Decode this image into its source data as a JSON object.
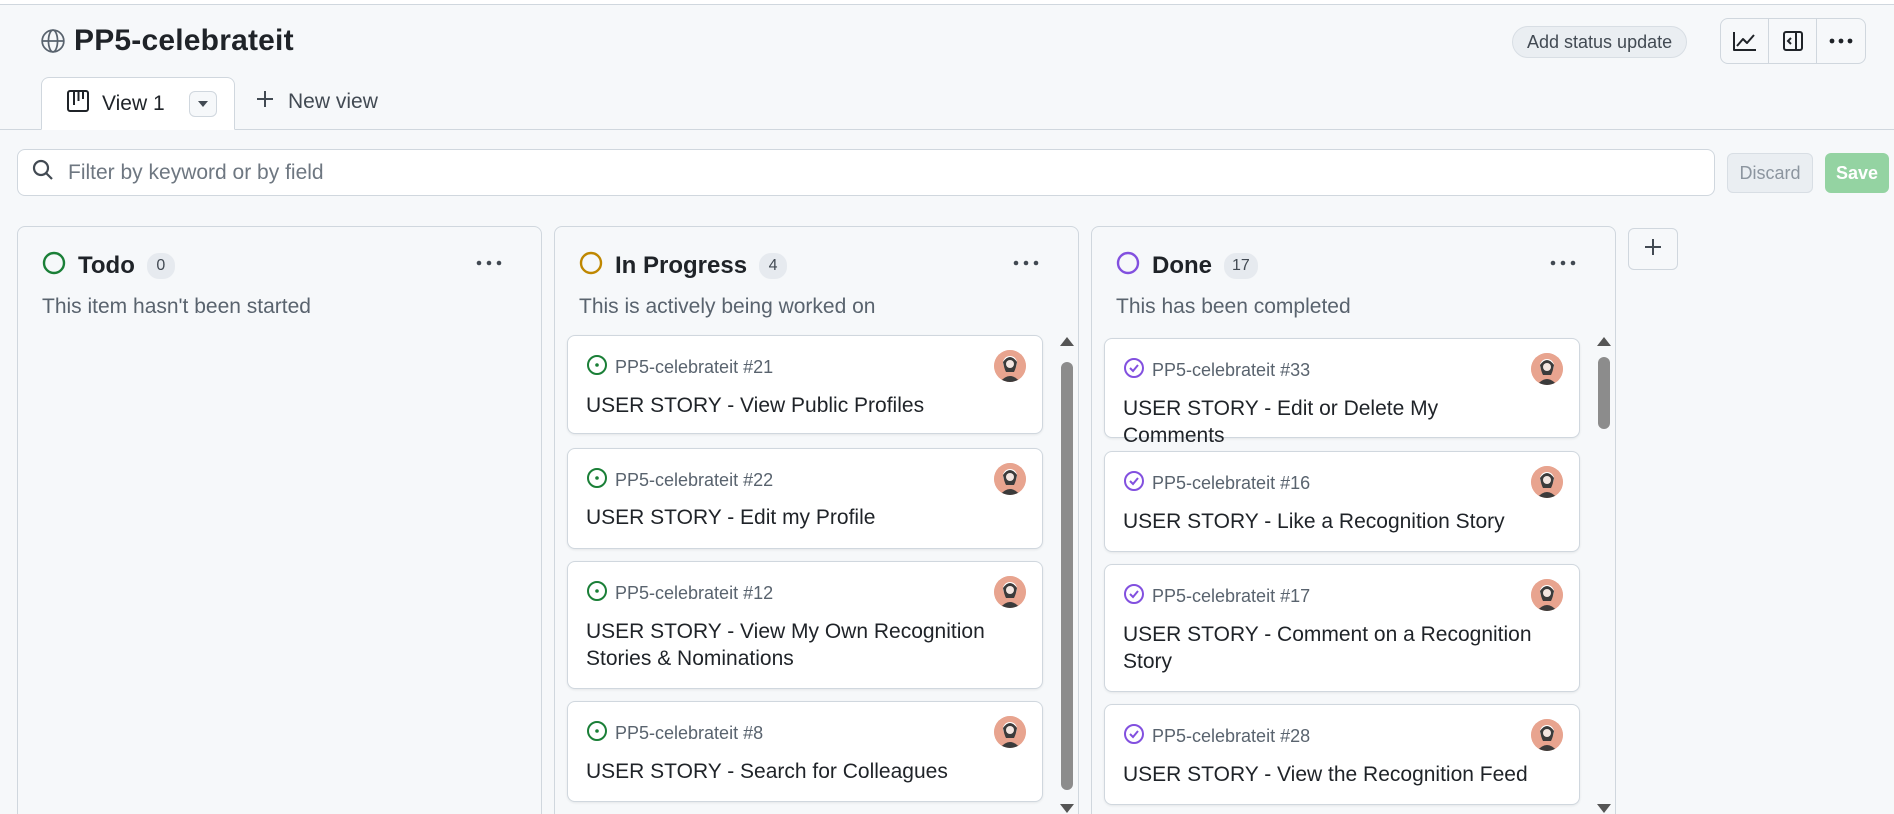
{
  "project": {
    "title": "PP5-celebrateit"
  },
  "header": {
    "status_update_label": "Add status update",
    "icons": [
      "insights-icon",
      "side-panel-icon",
      "more-options-icon"
    ]
  },
  "tabs": {
    "active_label": "View 1",
    "new_view_label": "New view"
  },
  "filter": {
    "placeholder": "Filter by keyword or by field",
    "value": "",
    "discard_label": "Discard",
    "save_label": "Save"
  },
  "colors": {
    "todo": "#1a7f37",
    "in_progress": "#bf8700",
    "done": "#8250df",
    "save_disabled": "#94d3a2"
  },
  "columns": [
    {
      "name": "Todo",
      "count": "0",
      "description": "This item hasn't been started",
      "cards": []
    },
    {
      "name": "In Progress",
      "count": "4",
      "description": "This is actively being worked on",
      "cards": [
        {
          "ref": "PP5-celebrateit #21",
          "title": "USER STORY - View Public Profiles"
        },
        {
          "ref": "PP5-celebrateit #22",
          "title": "USER STORY - Edit my Profile"
        },
        {
          "ref": "PP5-celebrateit #12",
          "title": "USER STORY - View My Own Recognition Stories & Nominations"
        },
        {
          "ref": "PP5-celebrateit #8",
          "title": "USER STORY - Search for Colleagues"
        }
      ]
    },
    {
      "name": "Done",
      "count": "17",
      "description": "This has been completed",
      "cards": [
        {
          "ref": "PP5-celebrateit #33",
          "title": "USER STORY - Edit or Delete My Comments"
        },
        {
          "ref": "PP5-celebrateit #16",
          "title": "USER STORY - Like a Recognition Story"
        },
        {
          "ref": "PP5-celebrateit #17",
          "title": "USER STORY - Comment on a Recognition Story"
        },
        {
          "ref": "PP5-celebrateit #28",
          "title": "USER STORY - View the Recognition Feed"
        }
      ]
    }
  ]
}
